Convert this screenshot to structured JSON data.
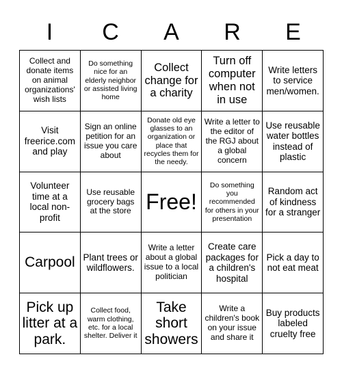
{
  "header": {
    "letters": [
      "I",
      "C",
      "A",
      "R",
      "E"
    ]
  },
  "grid": {
    "rows": 5,
    "columns": 5,
    "cells": [
      {
        "text": "Collect and donate items on animal organizations' wish lists",
        "size": "sm"
      },
      {
        "text": "Do something nice for an elderly neighbor or assisted living home",
        "size": "xs"
      },
      {
        "text": "Collect change for a charity",
        "size": "lg"
      },
      {
        "text": "Turn off computer when not in use",
        "size": "lg"
      },
      {
        "text": "Write letters to service men/women.",
        "size": "md"
      },
      {
        "text": "Visit freerice.com and play",
        "size": "md"
      },
      {
        "text": "Sign an online petition for an issue you care about",
        "size": "sm"
      },
      {
        "text": "Donate old eye glasses to an organization or place that recycles them for the needy.",
        "size": "xs"
      },
      {
        "text": "Write a letter to the editor of the RGJ about a global concern",
        "size": "sm"
      },
      {
        "text": "Use reusable water bottles instead of plastic",
        "size": "md"
      },
      {
        "text": "Volunteer time at a local non-profit",
        "size": "md"
      },
      {
        "text": "Use reusable grocery bags at the store",
        "size": "sm"
      },
      {
        "text": "Free!",
        "size": "xxl"
      },
      {
        "text": "Do something you recommended for others in your presentation",
        "size": "xs"
      },
      {
        "text": "Random act of kindness for a stranger",
        "size": "md"
      },
      {
        "text": "Carpool",
        "size": "xl"
      },
      {
        "text": "Plant trees or wildflowers.",
        "size": "md"
      },
      {
        "text": "Write a letter about a global issue to a local politician",
        "size": "sm"
      },
      {
        "text": "Create care packages for a children's hospital",
        "size": "md"
      },
      {
        "text": "Pick a day to not eat meat",
        "size": "md"
      },
      {
        "text": "Pick up litter at a park.",
        "size": "xl"
      },
      {
        "text": "Collect food, warm clothing, etc. for a local shelter. Deliver it",
        "size": "xs"
      },
      {
        "text": "Take short showers",
        "size": "xl"
      },
      {
        "text": "Write a children's book on your issue and share it",
        "size": "sm"
      },
      {
        "text": "Buy products labeled cruelty free",
        "size": "md"
      }
    ]
  }
}
